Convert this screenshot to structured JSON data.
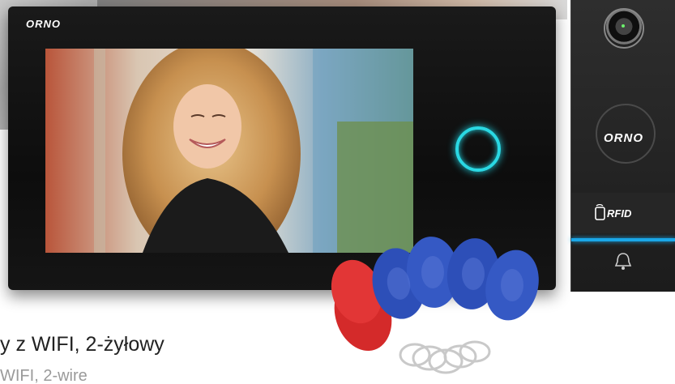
{
  "monitor": {
    "brand": "ORNO"
  },
  "outdoor_panel": {
    "brand": "ORNO",
    "rfid_label": "RFID",
    "camera_icon": "camera-lens-icon",
    "bell_icon": "bell-icon"
  },
  "captions": {
    "line_pl": "y z WIFI, 2-żyłowy",
    "line_en": "WIFI, 2-wire"
  },
  "colors": {
    "accent_ring": "#2ad8e3",
    "panel_strip": "#1aa7e8",
    "fob_blue": "#2d4fb8",
    "fob_red": "#d42a2a"
  }
}
